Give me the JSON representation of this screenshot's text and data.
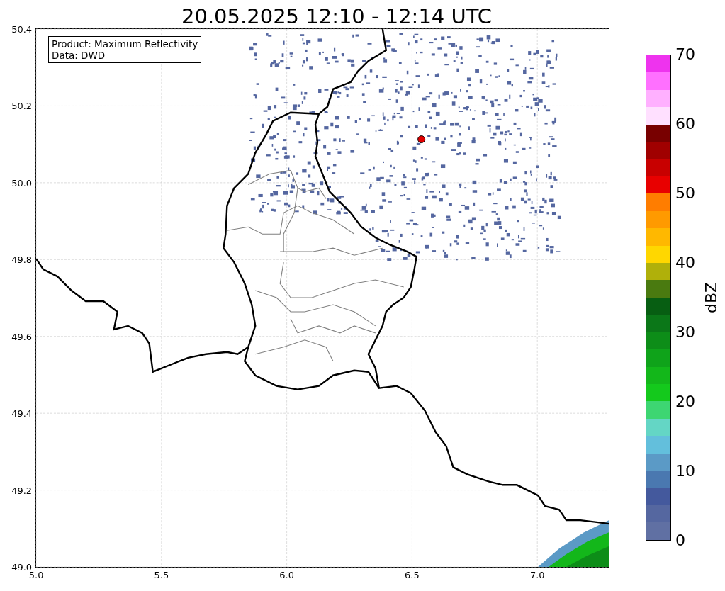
{
  "title": "20.05.2025 12:10 - 12:14 UTC",
  "map": {
    "info_box": [
      "Product: Maximum Reflectivity",
      "Data: DWD"
    ],
    "xticks": [
      "5.0",
      "5.5",
      "6.0",
      "6.5",
      "7.0"
    ],
    "yticks": [
      "50.4",
      "50.2",
      "50.0",
      "49.8",
      "49.6",
      "49.4",
      "49.2",
      "49.0"
    ]
  },
  "colorbar": {
    "label": "dBZ",
    "ticks": [
      "70",
      "60",
      "50",
      "40",
      "30",
      "20",
      "10",
      "0"
    ],
    "bins": [
      {
        "color": "#ee33ee"
      },
      {
        "color": "#ff70ff"
      },
      {
        "color": "#ffb0ff"
      },
      {
        "color": "#ffe0ff"
      },
      {
        "color": "#780000"
      },
      {
        "color": "#a00000"
      },
      {
        "color": "#c80000"
      },
      {
        "color": "#e80000"
      },
      {
        "color": "#ff7d00"
      },
      {
        "color": "#ff9a00"
      },
      {
        "color": "#ffb800"
      },
      {
        "color": "#ffd700"
      },
      {
        "color": "#b0b00a"
      },
      {
        "color": "#4a7a10"
      },
      {
        "color": "#075e12"
      },
      {
        "color": "#0b7718"
      },
      {
        "color": "#0d8d18"
      },
      {
        "color": "#0fa31a"
      },
      {
        "color": "#13b71a"
      },
      {
        "color": "#14c91c"
      },
      {
        "color": "#3dd672"
      },
      {
        "color": "#64d6c5"
      },
      {
        "color": "#63bfdc"
      },
      {
        "color": "#5b9ac6"
      },
      {
        "color": "#4a78b0"
      },
      {
        "color": "#44599d"
      },
      {
        "color": "#5567a0"
      },
      {
        "color": "#6070a3"
      }
    ]
  }
}
